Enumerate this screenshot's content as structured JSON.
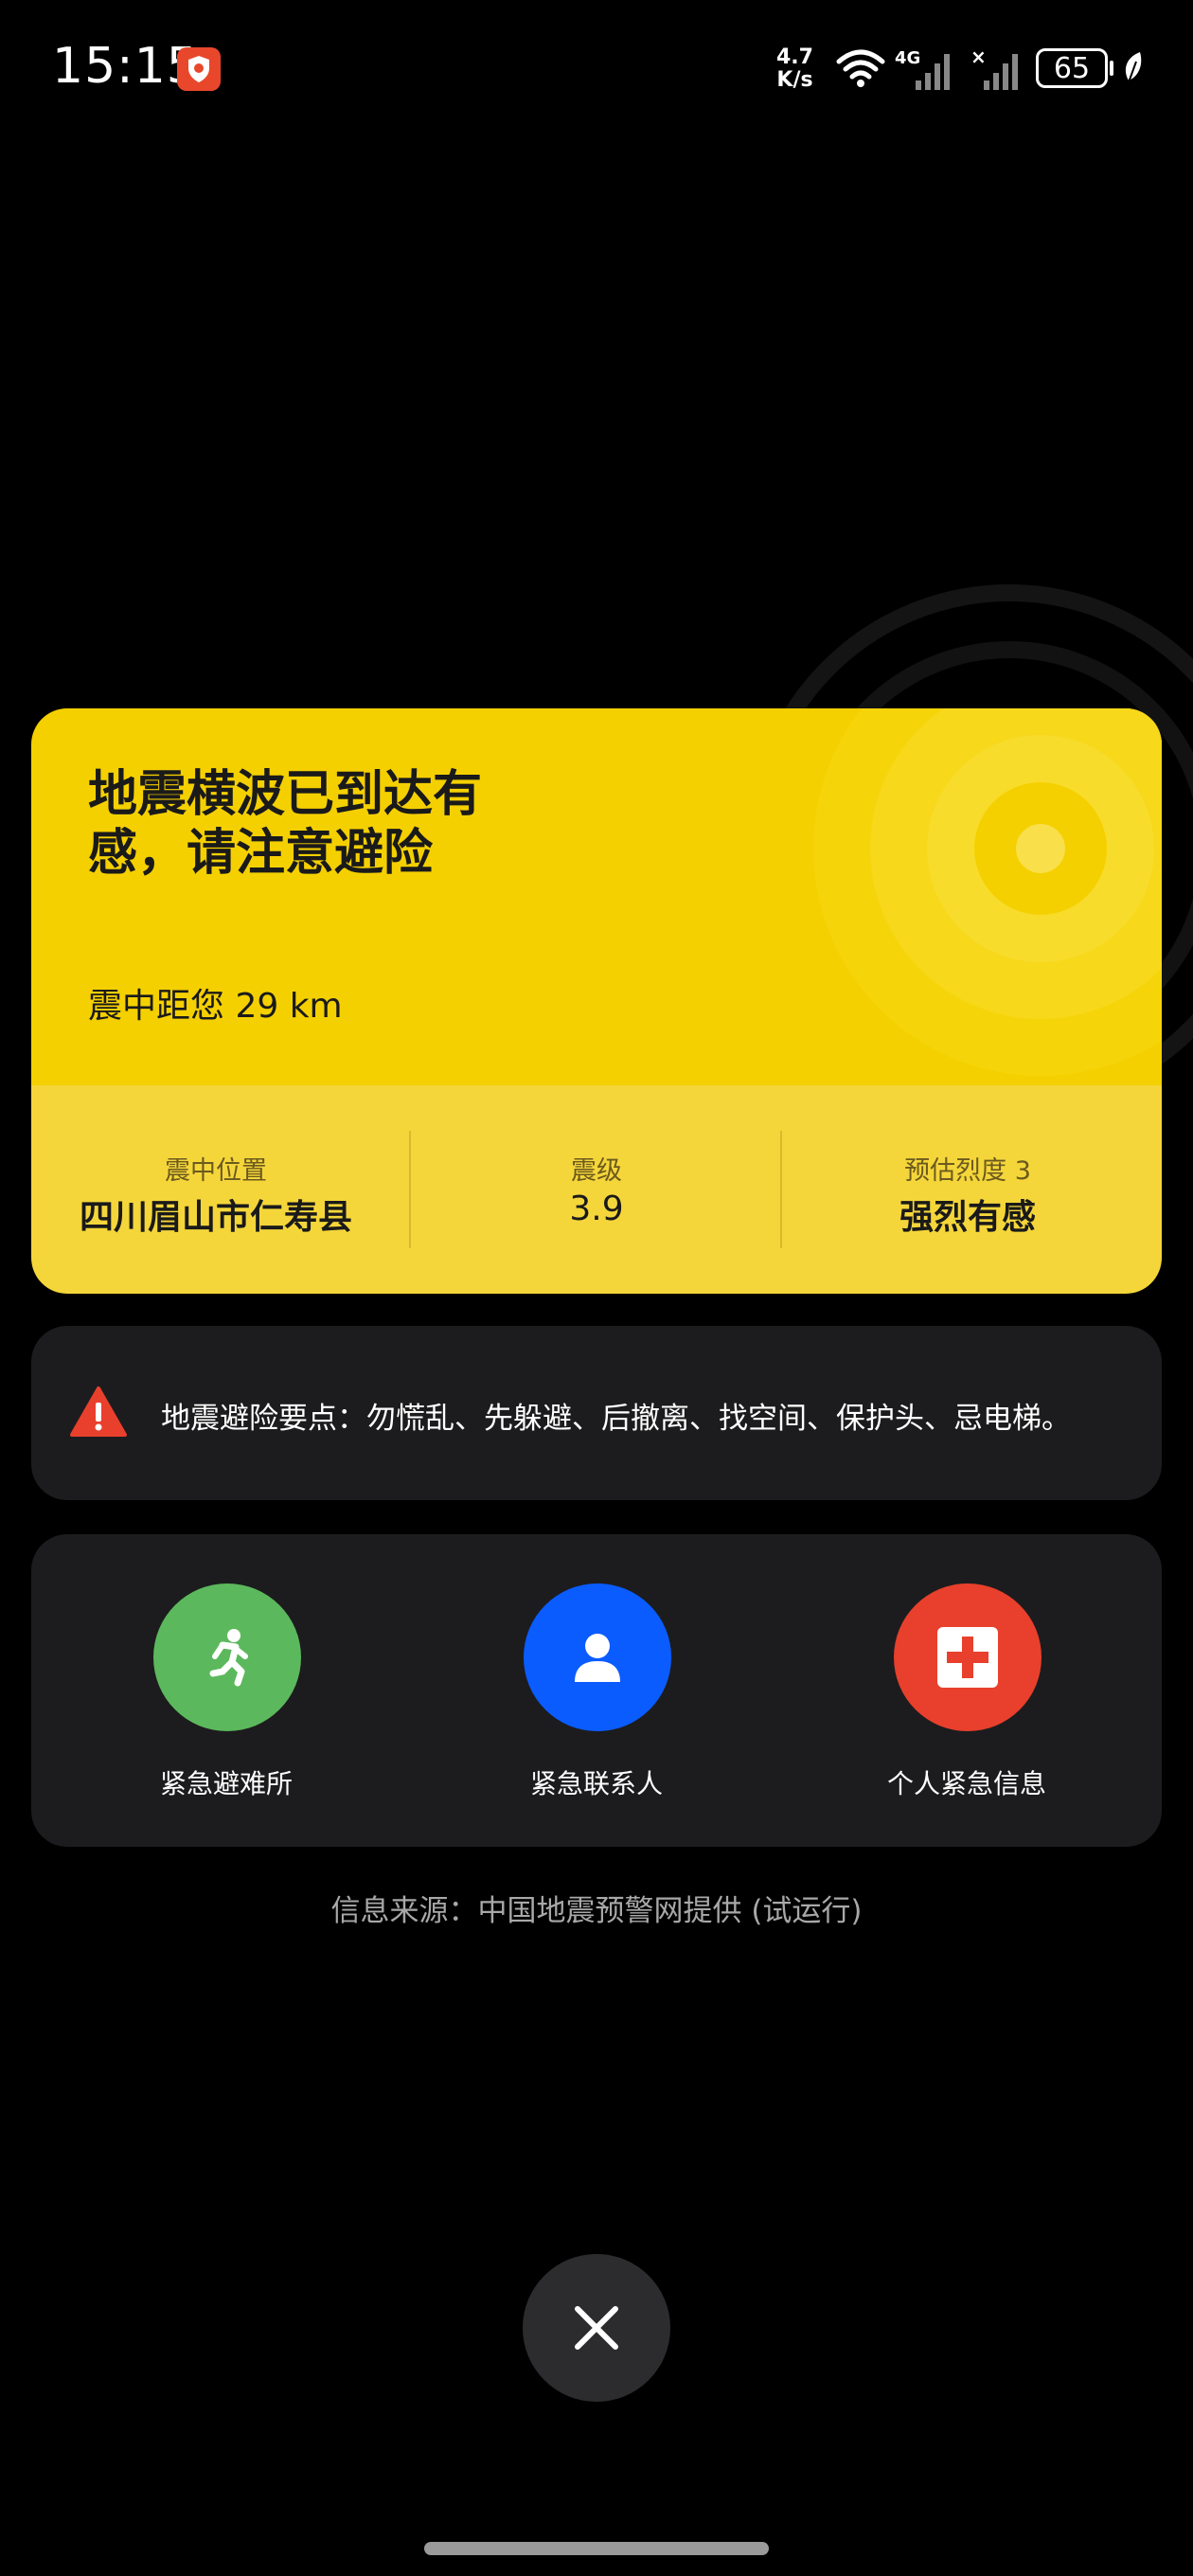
{
  "status_bar": {
    "time": "15:15",
    "net_speed_value": "4.7",
    "net_speed_unit": "K/s",
    "network_type": "4G",
    "battery": "65"
  },
  "quake_card": {
    "headline": "地震横波已到达有感，请注意避险",
    "distance": "震中距您 29 km",
    "stats": {
      "location_label": "震中位置",
      "location_value": "四川眉山市仁寿县",
      "magnitude_label": "震级",
      "magnitude_value": "3.9",
      "intensity_label": "预估烈度 3",
      "intensity_value": "强烈有感"
    },
    "colors": {
      "top": "#f5d000",
      "bottom": "#f5d63a"
    }
  },
  "safety_tip": {
    "text": "地震避险要点：勿慌乱、先躲避、后撤离、找空间、保护头、忌电梯。",
    "icon": "warning-icon"
  },
  "actions": [
    {
      "label": "紧急避难所",
      "icon": "running-person-icon",
      "color": "#5cb85c"
    },
    {
      "label": "紧急联系人",
      "icon": "person-icon",
      "color": "#0a5cff"
    },
    {
      "label": "个人紧急信息",
      "icon": "medical-cross-icon",
      "color": "#e8402c"
    }
  ],
  "source": "信息来源：中国地震预警网提供 (试运行)",
  "close": {
    "icon": "close-icon"
  }
}
